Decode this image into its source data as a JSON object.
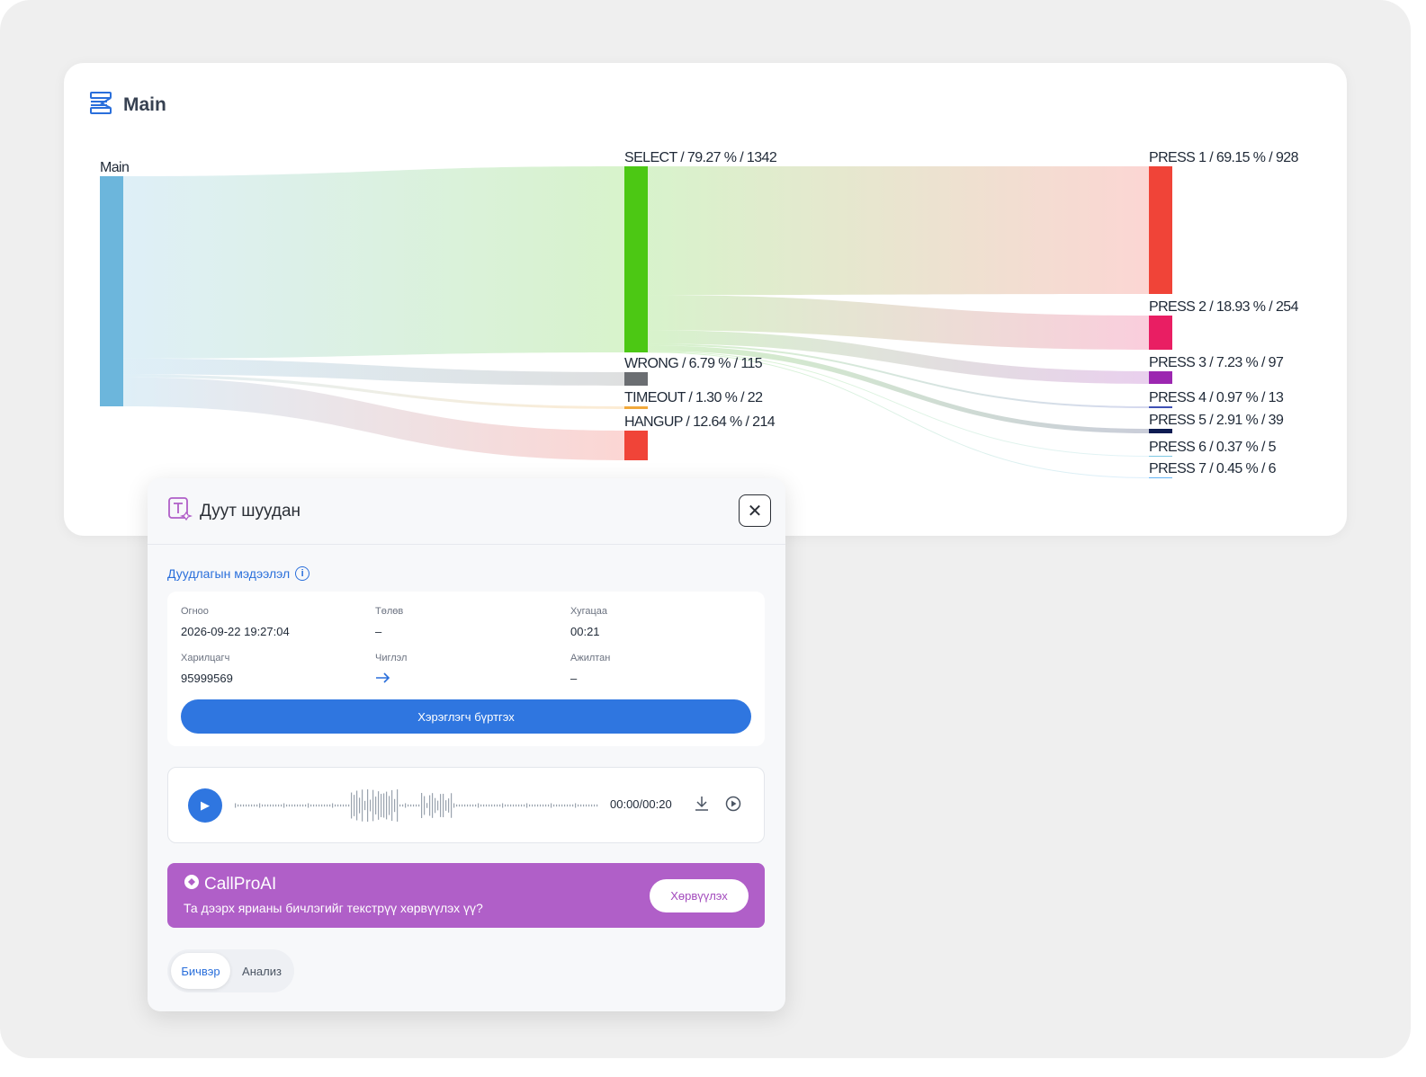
{
  "flow": {
    "title": "Main",
    "source": {
      "label": "Main",
      "color": "#6cb6dc"
    },
    "stage1": [
      {
        "label": "SELECT / 79.27 % / 1342",
        "value": 1342,
        "color": "#4cc814"
      },
      {
        "label": "WRONG / 6.79 % / 115",
        "value": 115,
        "color": "#6b6e72"
      },
      {
        "label": "TIMEOUT / 1.30 % / 22",
        "value": 22,
        "color": "#f2a93b"
      },
      {
        "label": "HANGUP / 12.64 % / 214",
        "value": 214,
        "color": "#f04438"
      }
    ],
    "stage2": [
      {
        "label": "PRESS 1 / 69.15 % / 928",
        "value": 928,
        "color": "#f04438"
      },
      {
        "label": "PRESS 2 / 18.93 % / 254",
        "value": 254,
        "color": "#e91e63"
      },
      {
        "label": "PRESS 3 / 7.23 % / 97",
        "value": 97,
        "color": "#9c27b0"
      },
      {
        "label": "PRESS 4 / 0.97 % / 13",
        "value": 13,
        "color": "#3f51b5"
      },
      {
        "label": "PRESS 5 / 2.91 % / 39",
        "value": 39,
        "color": "#0d1b52"
      },
      {
        "label": "PRESS 6 / 0.37 % / 5",
        "value": 5,
        "color": "#7ec8e3"
      },
      {
        "label": "PRESS 7 / 0.45 % / 6",
        "value": 6,
        "color": "#64b5f6"
      }
    ]
  },
  "modal": {
    "title": "Дуут шуудан",
    "close_icon": "close-icon",
    "section_title": "Дуудлагын мэдээлэл",
    "fields": {
      "date": {
        "label": "Огноо",
        "value": "2026-09-22 19:27:04"
      },
      "status": {
        "label": "Төлөв",
        "value": "–"
      },
      "duration": {
        "label": "Хугацаа",
        "value": "00:21"
      },
      "customer": {
        "label": "Харилцагч",
        "value": "95999569"
      },
      "direction": {
        "label": "Чиглэл",
        "icon": "arrow-right-icon"
      },
      "agent": {
        "label": "Ажилтан",
        "value": "–"
      }
    },
    "register_button": "Хэрэглэгч бүртгэх",
    "player": {
      "time": "00:00/00:20"
    },
    "ai": {
      "brand": "CallProAI",
      "message": "Та дээрх ярианы бичлэгийг текстрүү хөрвүүлэх үү?",
      "button": "Хөрвүүлэх",
      "color": "#b05fc8"
    },
    "tabs": {
      "transcript": "Бичвэр",
      "analysis": "Анализ"
    }
  }
}
